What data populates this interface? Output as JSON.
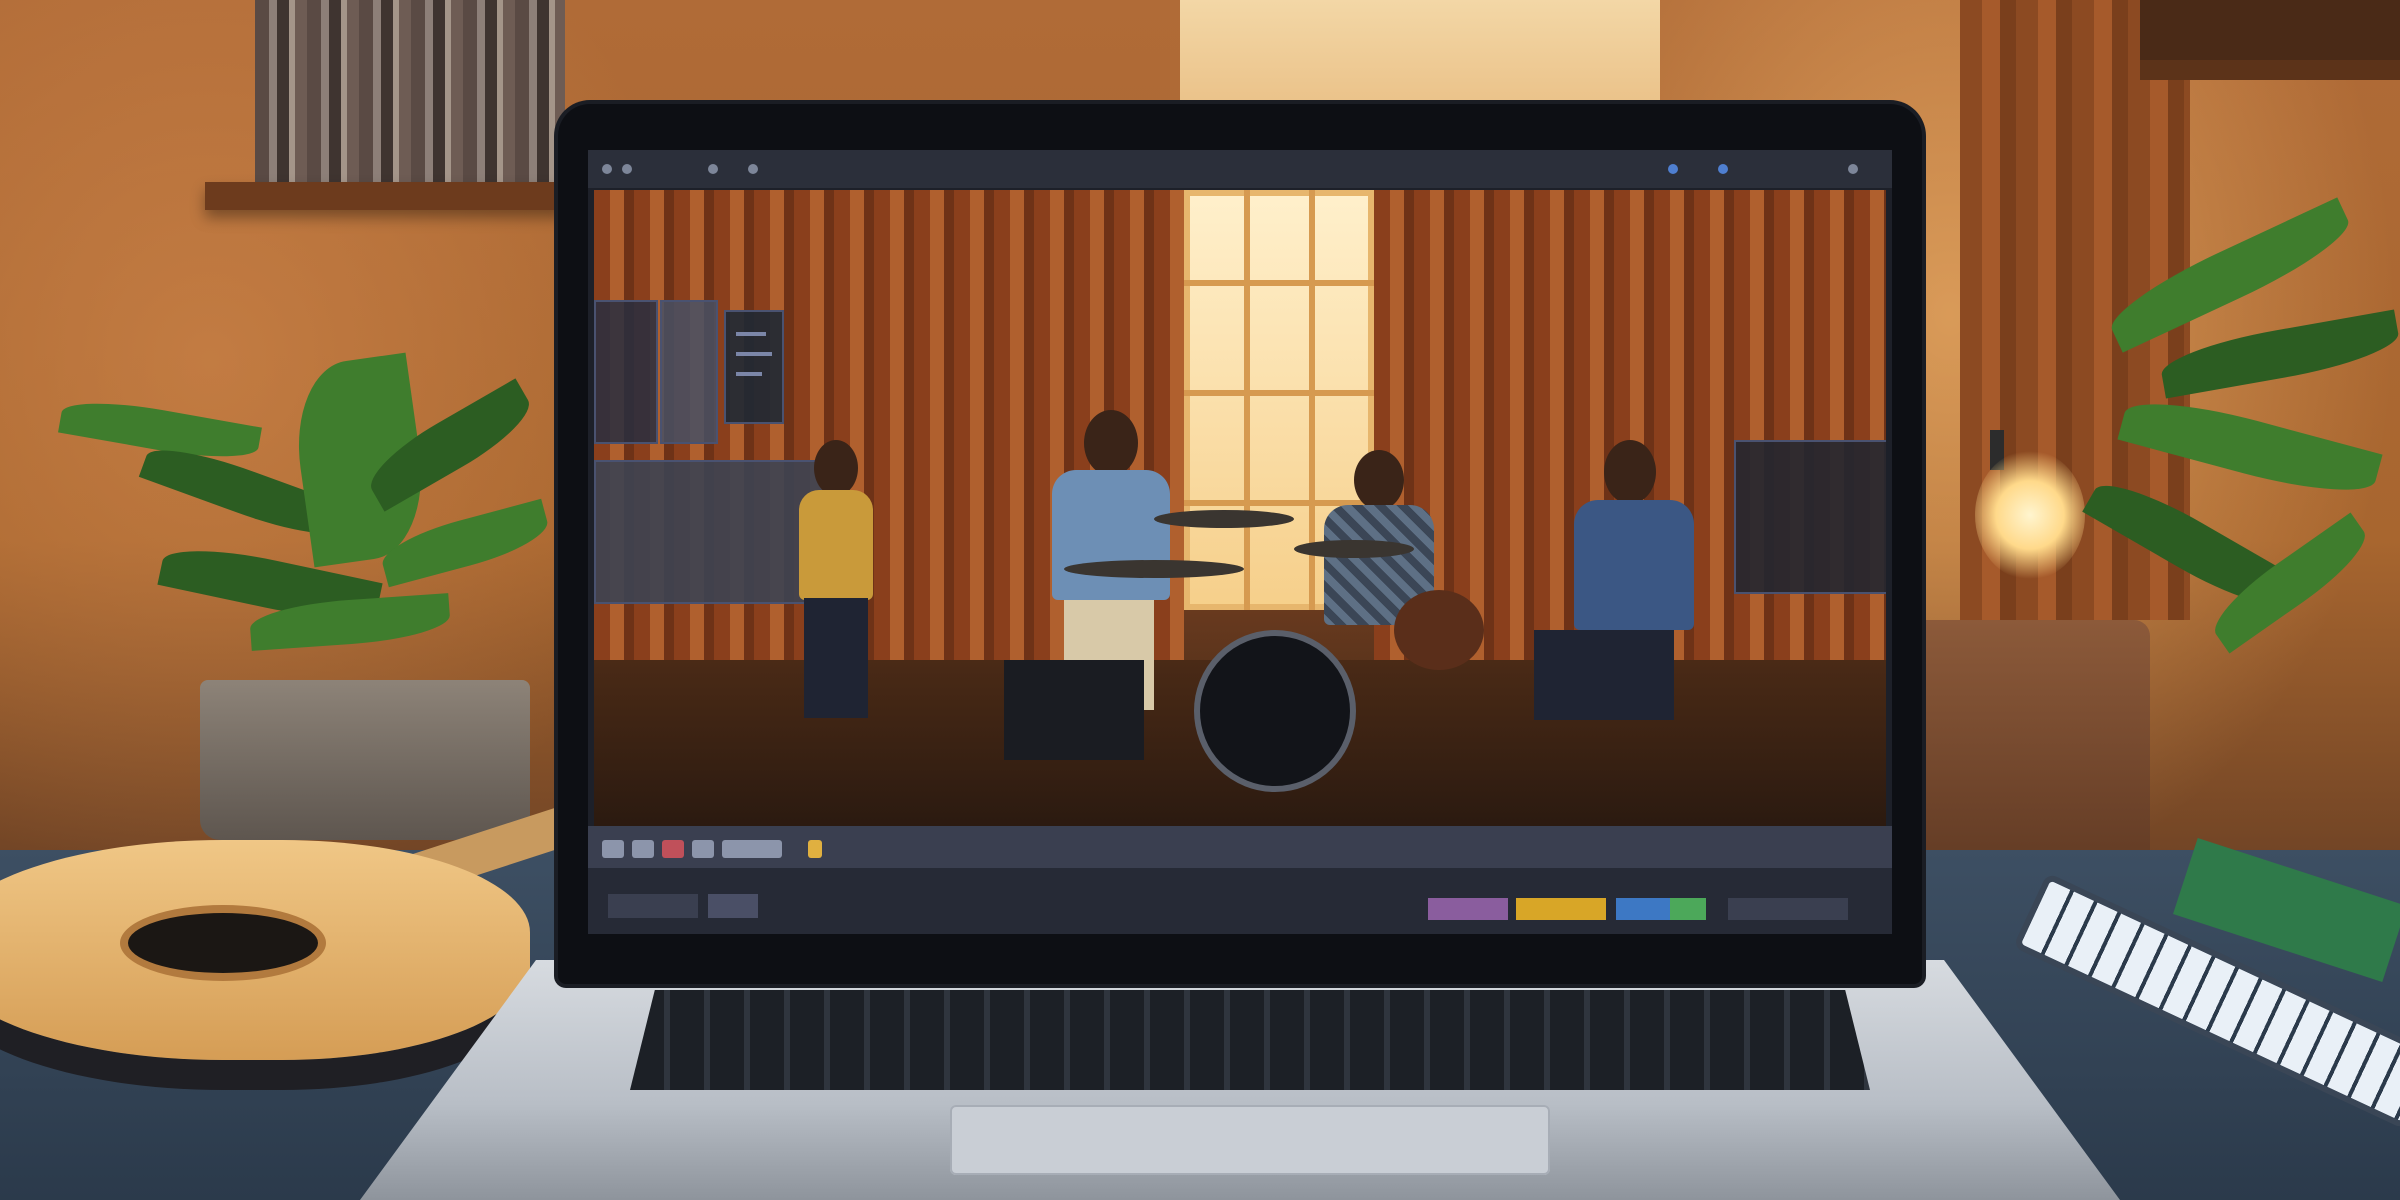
{
  "scene": {
    "description_colors": {
      "wall": "#a8662f",
      "desk": "#3d4f63",
      "screen_bg": "#1d2029",
      "timeline_purple": "#8a5d9e",
      "timeline_yellow": "#d8a627",
      "timeline_blue": "#3d78c4",
      "timeline_green": "#4ca85a"
    },
    "icons": [
      "guitar-icon",
      "plant-icon",
      "laptop-icon",
      "lamp-icon",
      "midi-keyboard-icon",
      "drum-icon"
    ]
  }
}
